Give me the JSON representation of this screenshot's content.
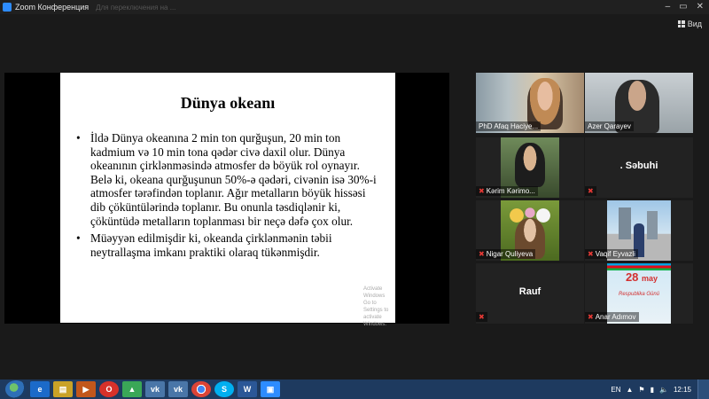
{
  "window": {
    "title": "Zoom Конференция",
    "ghost_text": "Для переключения на ...",
    "view_label": "Вид"
  },
  "slide": {
    "title": "Dünya okeanı",
    "bullets": [
      "İldə Dünya okeanına 2 min ton qurğuşun, 20 min ton kadmium və 10 min tona qədər civə daxil olur. Dünya okeanının çirklənməsində atmosfer də böyük rol oynayır. Belə ki, okeana qurğuşunun 50%-ə qədəri, civənin isə 30%-i atmosfer tərəfindən toplanır. Ağır metalların böyük hissəsi dib çöküntülərində toplanır. Bu onunla təsdiqlənir ki, çöküntüdə metalların toplanması bir neçə dəfə çox olur.",
      "Müəyyən edilmişdir ki, okeanda çirklənmənin təbii neytrallaşma imkanı praktiki olaraq tükənmişdir."
    ],
    "watermark_line1": "Activate Windows",
    "watermark_line2": "Go to Settings to activate Windows."
  },
  "participants": [
    {
      "name": "PhD Afaq Haciye...",
      "muted": false,
      "active": true,
      "display_name": ""
    },
    {
      "name": "Azer Qarayev",
      "muted": false,
      "active": false,
      "display_name": ""
    },
    {
      "name": "Kərim Kərimo...",
      "muted": true,
      "active": false,
      "display_name": ""
    },
    {
      "name": "",
      "muted": true,
      "active": false,
      "display_name": ". Səbuhi"
    },
    {
      "name": "Nigar Quliyeva",
      "muted": true,
      "active": false,
      "display_name": ""
    },
    {
      "name": "Vaqif Eyvazli",
      "muted": true,
      "active": false,
      "display_name": ""
    },
    {
      "name": "",
      "muted": true,
      "active": false,
      "display_name": "Rauf"
    },
    {
      "name": "Anar Adımov",
      "muted": true,
      "active": false,
      "display_name": ""
    }
  ],
  "poster_text": {
    "big": "28",
    "month": "may",
    "sub": "Respublika Günü"
  },
  "taskbar": {
    "language": "EN",
    "time": "12:15"
  },
  "colors": {
    "active_speaker": "#d6e21c",
    "muted_icon": "#e53935",
    "taskbar": "#1e3a5f"
  }
}
